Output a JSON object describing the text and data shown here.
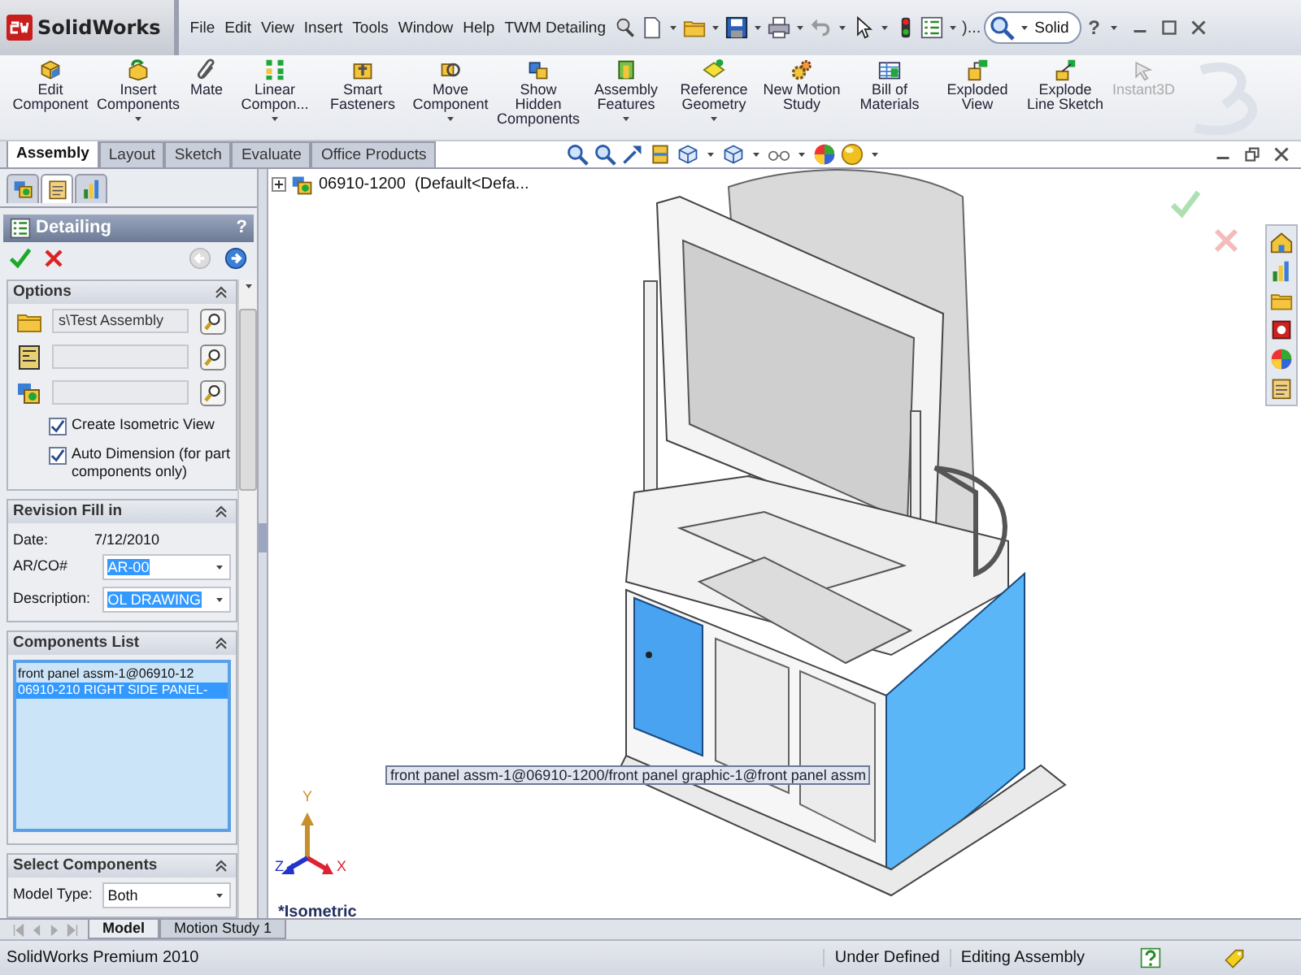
{
  "title_bar": {
    "logo": "SolidWorks",
    "menu": [
      "File",
      "Edit",
      "View",
      "Insert",
      "Tools",
      "Window",
      "Help",
      "TWM Detailing"
    ],
    "more": ")...",
    "search": {
      "value": "Solid"
    },
    "help": "?"
  },
  "ribbon": [
    {
      "label": "Edit Component",
      "dropdown": false,
      "disabled": false
    },
    {
      "label": "Insert Components",
      "dropdown": true,
      "disabled": false
    },
    {
      "label": "Mate",
      "dropdown": false,
      "disabled": false
    },
    {
      "label": "Linear Compon...",
      "dropdown": true,
      "disabled": false
    },
    {
      "label": "Smart Fasteners",
      "dropdown": false,
      "disabled": false
    },
    {
      "label": "Move Component",
      "dropdown": true,
      "disabled": false
    },
    {
      "label": "Show Hidden Components",
      "dropdown": false,
      "disabled": false
    },
    {
      "label": "Assembly Features",
      "dropdown": true,
      "disabled": false
    },
    {
      "label": "Reference Geometry",
      "dropdown": true,
      "disabled": false
    },
    {
      "label": "New Motion Study",
      "dropdown": false,
      "disabled": false
    },
    {
      "label": "Bill of Materials",
      "dropdown": false,
      "disabled": false
    },
    {
      "label": "Exploded View",
      "dropdown": false,
      "disabled": false
    },
    {
      "label": "Explode Line Sketch",
      "dropdown": false,
      "disabled": false
    },
    {
      "label": "Instant3D",
      "dropdown": false,
      "disabled": true
    }
  ],
  "command_tabs": [
    {
      "label": "Assembly",
      "selected": true
    },
    {
      "label": "Layout",
      "selected": false
    },
    {
      "label": "Sketch",
      "selected": false
    },
    {
      "label": "Evaluate",
      "selected": false
    },
    {
      "label": "Office Products",
      "selected": false
    }
  ],
  "panel_tabs": [
    {
      "selected": false
    },
    {
      "selected": true
    },
    {
      "selected": false
    }
  ],
  "property_manager": {
    "title": "Detailing",
    "help": "?",
    "sections": [
      {
        "kind": "options",
        "title": "Options",
        "fields": [
          {
            "kind": "folder",
            "value": "s\\Test Assembly"
          },
          {
            "kind": "drawing"
          },
          {
            "kind": "assembly"
          }
        ],
        "checkboxes": [
          {
            "label": "Create Isometric View",
            "checked": true
          },
          {
            "label": "Auto Dimension (for part components only)",
            "checked": true
          }
        ]
      },
      {
        "kind": "rows",
        "title": "Revision Fill in",
        "rows": [
          {
            "kind": "text",
            "label": "Date:",
            "value": "7/12/2010"
          },
          {
            "kind": "select",
            "label": "AR/CO#",
            "value": "AR-00"
          },
          {
            "kind": "select",
            "label": "Description:",
            "value": "OL DRAWING"
          }
        ]
      },
      {
        "kind": "list",
        "title": "Components List",
        "items": [
          {
            "text": "front panel assm-1@06910-12",
            "selected": false
          },
          {
            "text": "06910-210 RIGHT SIDE PANEL-",
            "selected": true
          }
        ]
      },
      {
        "kind": "rows",
        "title": "Select Components",
        "rows": [
          {
            "kind": "plain-select",
            "label": "Model Type:",
            "value": "Both"
          }
        ]
      }
    ]
  },
  "viewport": {
    "tree_item": "06910-1200  (Default<Defa...",
    "tooltip": "front panel assm-1@06910-1200/front panel graphic-1@front panel assm",
    "view_name": "*Isometric",
    "axes": {
      "x": "X",
      "y": "Y",
      "z": "Z"
    }
  },
  "bottom_tabs": [
    {
      "label": "Model",
      "selected": true
    },
    {
      "label": "Motion Study 1",
      "selected": false
    }
  ],
  "status_bar": {
    "product": "SolidWorks Premium 2010",
    "fields": [
      "Under Defined",
      "Editing Assembly"
    ]
  }
}
